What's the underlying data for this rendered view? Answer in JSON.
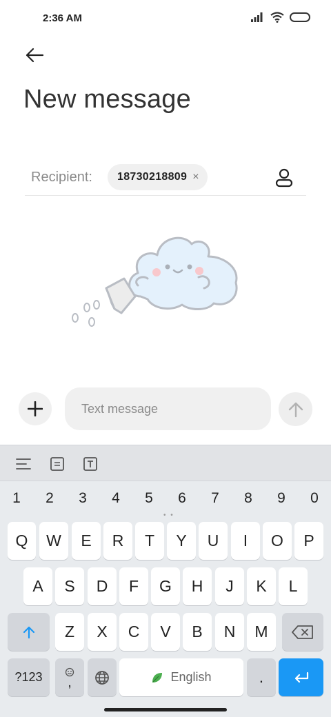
{
  "status_bar": {
    "time": "2:36 AM"
  },
  "header": {
    "title": "New message"
  },
  "recipient": {
    "label": "Recipient:",
    "chip_value": "18730218809",
    "chip_close": "×"
  },
  "composer": {
    "placeholder": "Text message"
  },
  "keyboard": {
    "numbers": [
      "1",
      "2",
      "3",
      "4",
      "5",
      "6",
      "7",
      "8",
      "9",
      "0"
    ],
    "row1": [
      "Q",
      "W",
      "E",
      "R",
      "T",
      "Y",
      "U",
      "I",
      "O",
      "P"
    ],
    "row2": [
      "A",
      "S",
      "D",
      "F",
      "G",
      "H",
      "J",
      "K",
      "L"
    ],
    "row3": [
      "Z",
      "X",
      "C",
      "V",
      "B",
      "N",
      "M"
    ],
    "symbols_key": "?123",
    "comma_key": ",",
    "space_label": "English",
    "period_key": ".",
    "accent_color": "#1a98f5"
  }
}
